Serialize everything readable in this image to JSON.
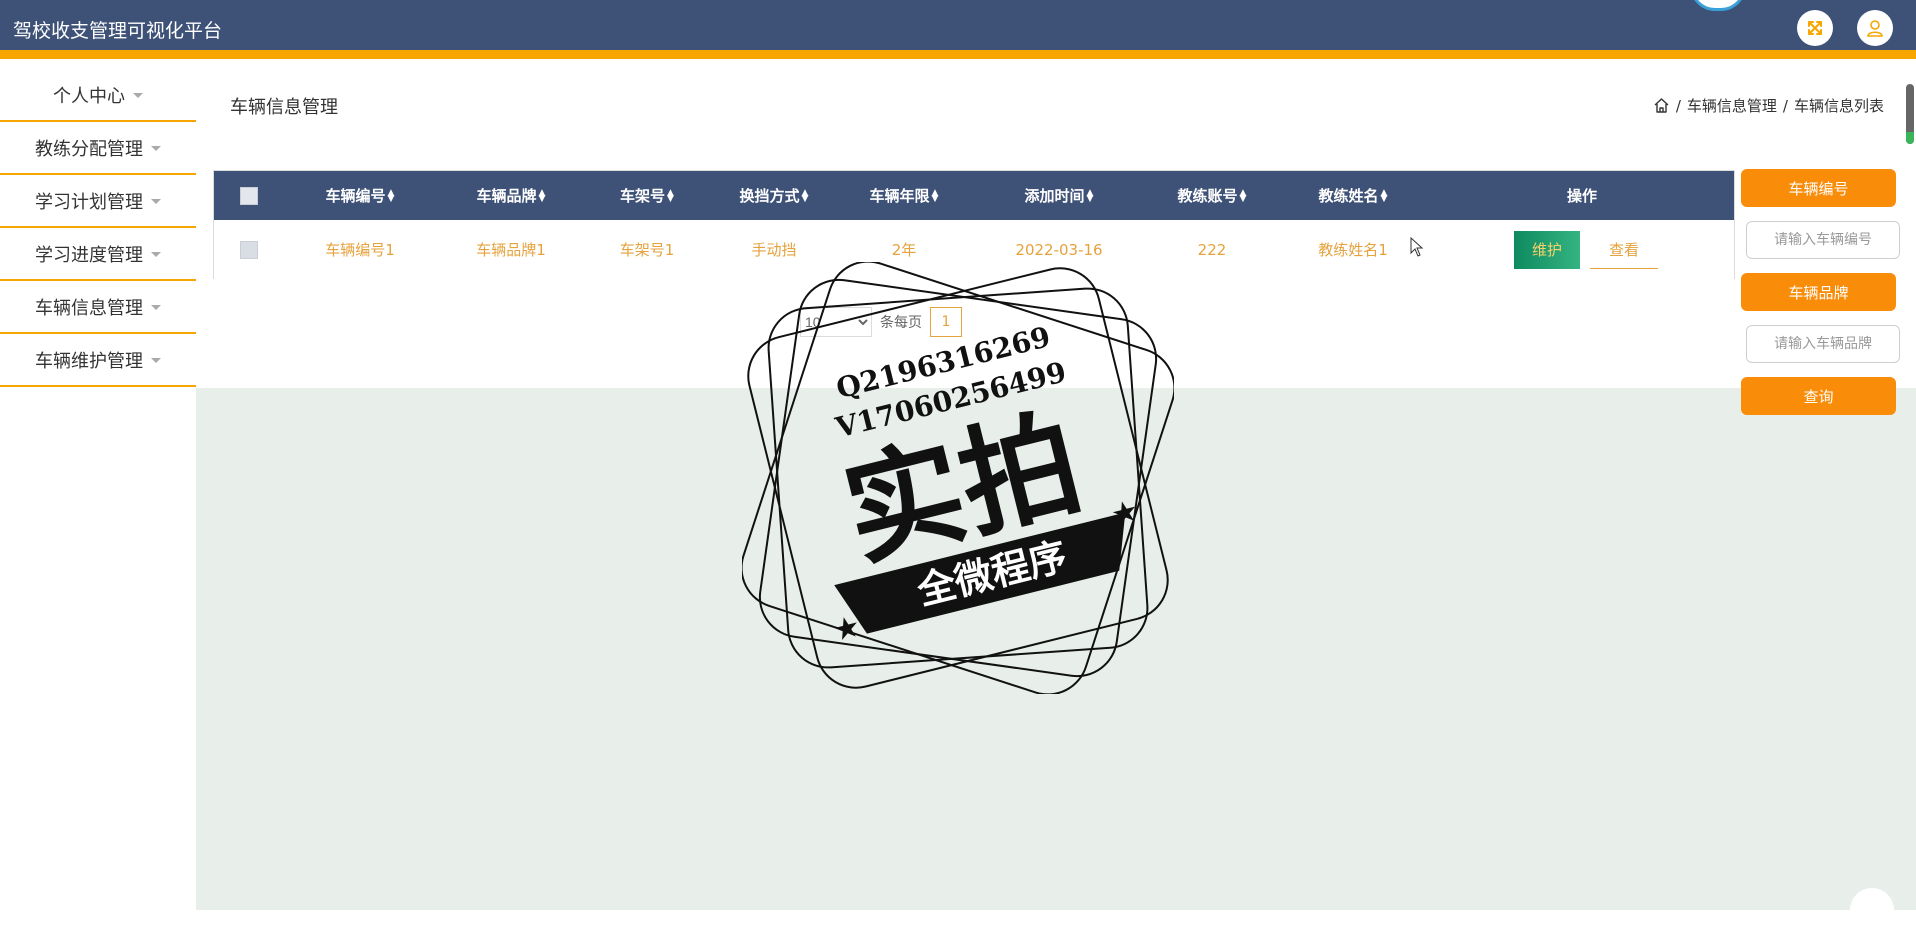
{
  "header": {
    "app_title": "驾校收支管理可视化平台",
    "icons": [
      "fullscreen-icon",
      "user-icon"
    ]
  },
  "sidebar": {
    "items": [
      {
        "label": "个人中心"
      },
      {
        "label": "教练分配管理"
      },
      {
        "label": "学习计划管理"
      },
      {
        "label": "学习进度管理"
      },
      {
        "label": "车辆信息管理"
      },
      {
        "label": "车辆维护管理"
      }
    ]
  },
  "page": {
    "title": "车辆信息管理",
    "breadcrumb": [
      "车辆信息管理",
      "车辆信息列表"
    ],
    "breadcrumb_sep": "/"
  },
  "table": {
    "columns": [
      "车辆编号",
      "车辆品牌",
      "车架号",
      "换挡方式",
      "车辆年限",
      "添加时间",
      "教练账号",
      "教练姓名",
      "操作"
    ],
    "rows": [
      {
        "cells": [
          "车辆编号1",
          "车辆品牌1",
          "车架号1",
          "手动挡",
          "2年",
          "2022-03-16",
          "222",
          "教练姓名1"
        ],
        "actions": [
          "维护",
          "查看"
        ]
      }
    ]
  },
  "pagination": {
    "page_size": "10",
    "page_size_suffix": "条每页",
    "current_page": "1"
  },
  "search": {
    "field1_label": "车辆编号",
    "field1_placeholder": "请输入车辆编号",
    "field2_label": "车辆品牌",
    "field2_placeholder": "请输入车辆品牌",
    "query_button": "查询"
  },
  "watermark": {
    "line1": "Q2196316269",
    "line2": "V17060256499",
    "main": "实拍",
    "banner": "全微程序"
  },
  "colors": {
    "header_bg": "#3e5177",
    "accent": "#f7a600",
    "orange_button": "#f98c08",
    "cell_text": "#e6a23c",
    "maintain_button": "#0e8a5f",
    "content_bg": "#e8efea"
  }
}
